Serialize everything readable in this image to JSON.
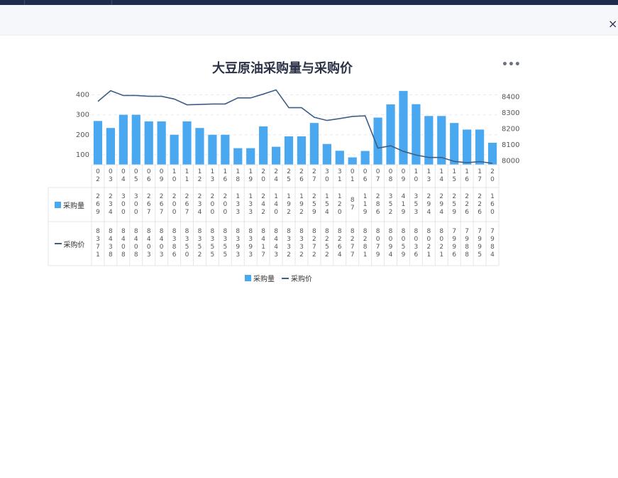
{
  "close_icon": "×",
  "more_icon": "•••",
  "chart_data": {
    "type": "bar",
    "title": "大豆原油采购量与采购价",
    "categories": [
      "02",
      "03",
      "04",
      "05",
      "06",
      "09",
      "10",
      "11",
      "12",
      "13",
      "16",
      "18",
      "19",
      "20",
      "24",
      "25",
      "26",
      "27",
      "30",
      "31",
      "01",
      "06",
      "07",
      "08",
      "09",
      "10",
      "13",
      "14",
      "15",
      "16",
      "17",
      "20"
    ],
    "series": [
      {
        "name": "采购量",
        "type": "bar",
        "axis": "left",
        "color": "#4aa8f0",
        "values": [
          269,
          234,
          300,
          300,
          267,
          267,
          200,
          267,
          234,
          200,
          200,
          133,
          133,
          242,
          140,
          192,
          192,
          259,
          154,
          120,
          87,
          119,
          286,
          352,
          419,
          353,
          294,
          294,
          259,
          226,
          226,
          160
        ]
      },
      {
        "name": "采购价",
        "type": "line",
        "axis": "right",
        "color": "#3d5f85",
        "values": [
          8371,
          8438,
          8408,
          8408,
          8403,
          8403,
          8386,
          8350,
          8352,
          8355,
          8355,
          8393,
          8393,
          8417,
          8443,
          8332,
          8332,
          8272,
          8252,
          8264,
          8277,
          8281,
          8079,
          8094,
          8059,
          8036,
          8021,
          8021,
          7996,
          7988,
          7995,
          7984
        ]
      }
    ],
    "y_left_ticks": [
      100,
      200,
      300,
      400
    ],
    "y_right_ticks": [
      8000,
      8100,
      8200,
      8300,
      8400
    ],
    "ylim_left": [
      50,
      430
    ],
    "ylim_right": [
      7975,
      8450
    ],
    "grid": true,
    "legend_position": "bottom",
    "data_table": true
  }
}
